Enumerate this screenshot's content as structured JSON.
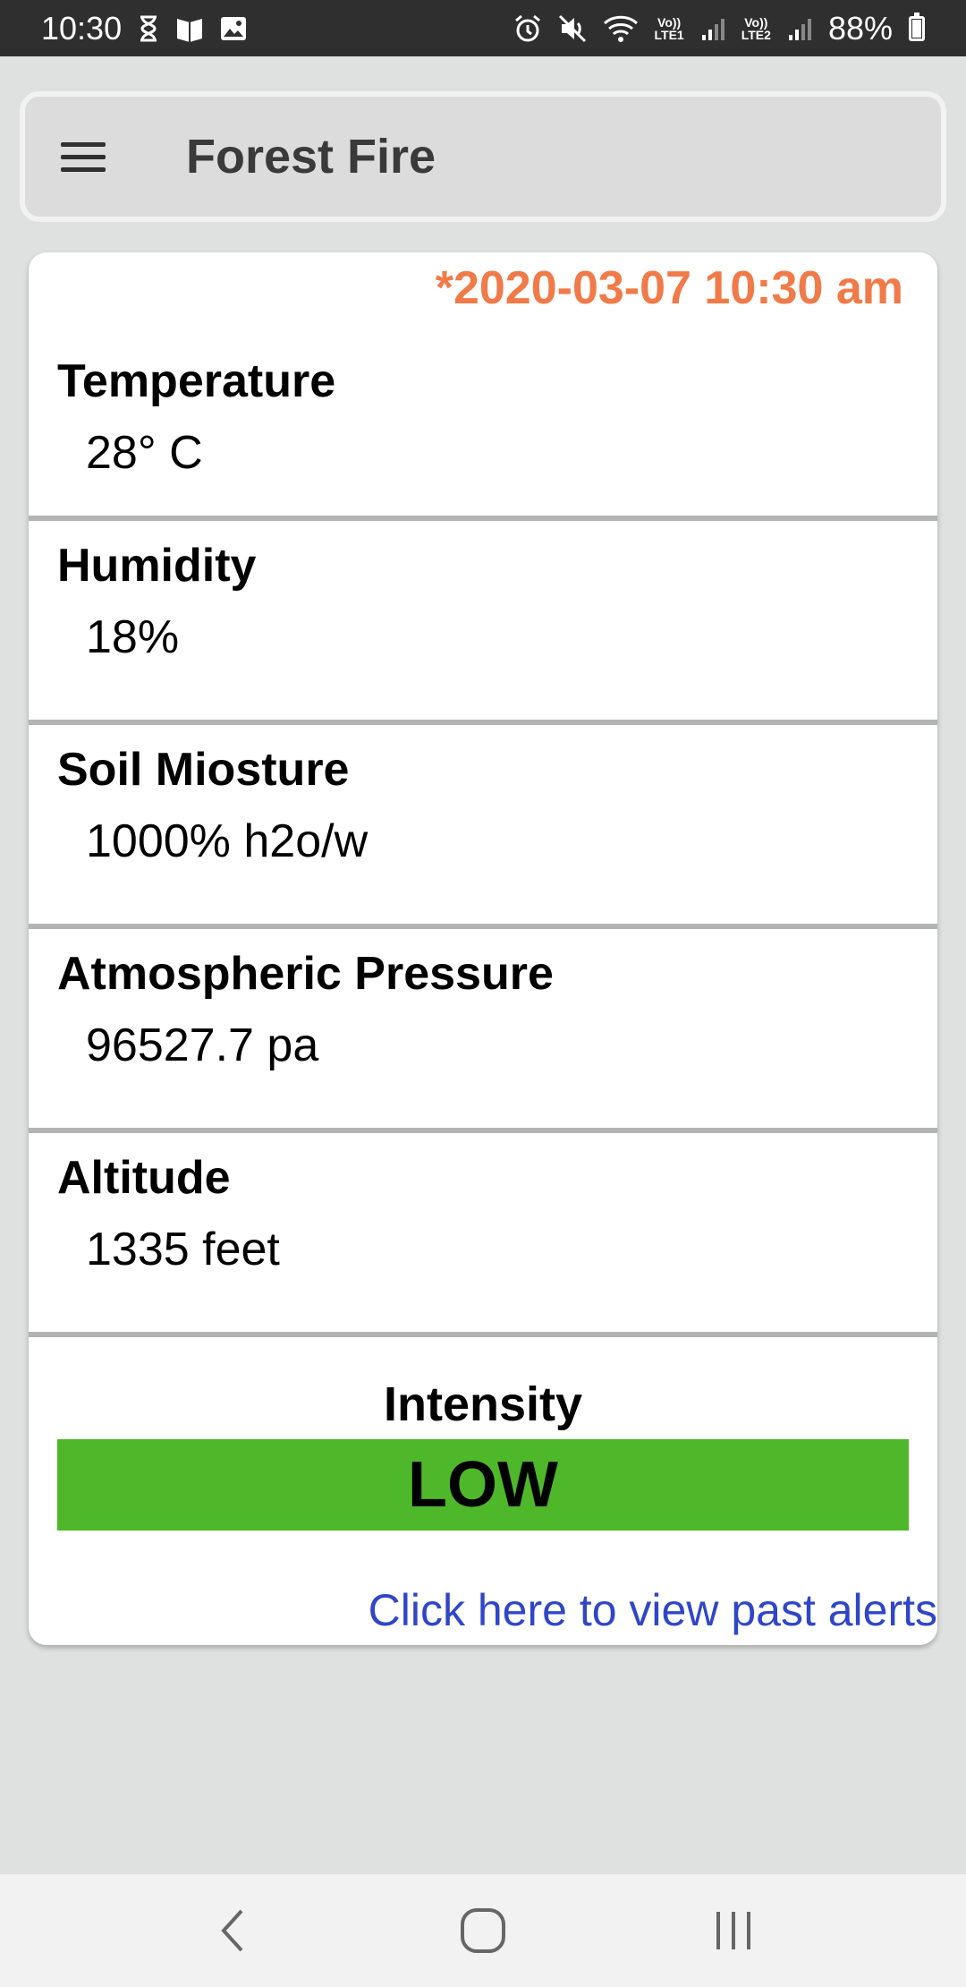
{
  "status_bar": {
    "time": "10:30",
    "battery": "88%",
    "battery_level": 0.88,
    "sim1_label": "LTE1",
    "sim2_label": "LTE2",
    "volte_label": "Vo))"
  },
  "app_bar": {
    "title": "Forest Fire"
  },
  "card": {
    "timestamp": "*2020-03-07 10:30 am",
    "readings": [
      {
        "label": "Temperature",
        "value": "28° C"
      },
      {
        "label": "Humidity",
        "value": "18%"
      },
      {
        "label": "Soil Miosture",
        "value": "1000% h2o/w"
      },
      {
        "label": "Atmospheric Pressure",
        "value": "96527.7 pa"
      },
      {
        "label": "Altitude",
        "value": "1335 feet"
      }
    ],
    "intensity_label": "Intensity",
    "intensity_value": "LOW",
    "intensity_color": "#4fb82a",
    "past_alerts_link": "Click here to view past alerts"
  },
  "colors": {
    "timestamp": "#f07a48",
    "link": "#2f46c8",
    "status_bar": "#2f2f2f",
    "background": "#dfe0e0"
  }
}
